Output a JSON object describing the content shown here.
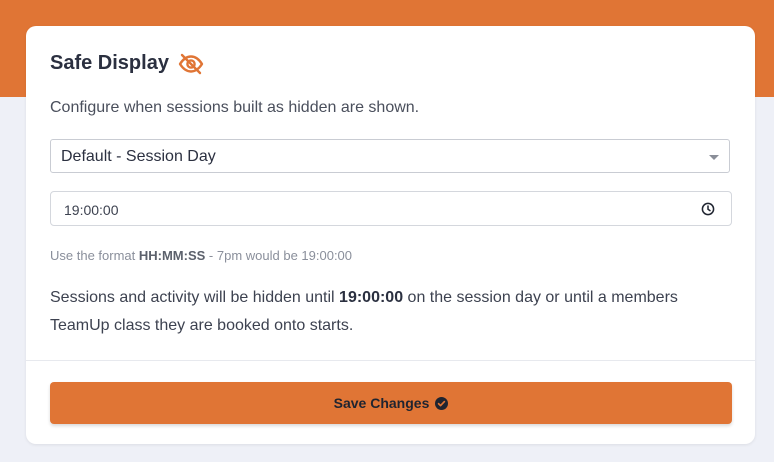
{
  "card": {
    "title": "Safe Display",
    "title_icon": "eye-slash-icon",
    "description": "Configure when sessions built as hidden are shown.",
    "display_select": {
      "selected": "Default - Session Day",
      "icon": "caret-down-icon"
    },
    "time_input": {
      "value": "19:00:00",
      "icon": "clock-icon"
    },
    "hint": {
      "prefix": "Use the format ",
      "format": "HH:MM:SS",
      "suffix": " - 7pm would be 19:00:00"
    },
    "note": {
      "before": "Sessions and activity will be hidden until ",
      "time": "19:00:00",
      "after": " on the session day or until a members TeamUp class they are booked onto starts."
    },
    "save_button": {
      "label": "Save Changes",
      "icon": "check-circle-icon"
    }
  },
  "colors": {
    "accent": "#e07535",
    "page_background": "#eef0f7",
    "card_background": "#ffffff",
    "heading": "#2b3040"
  }
}
